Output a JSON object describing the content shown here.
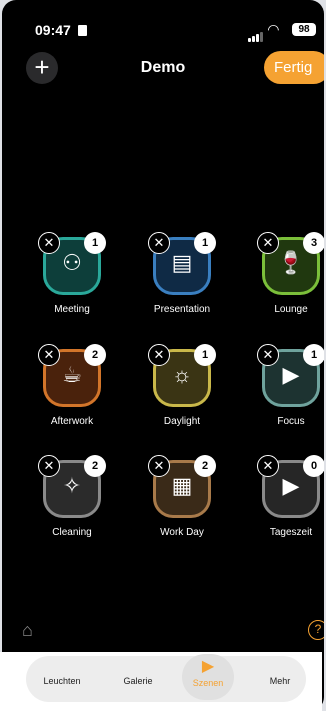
{
  "status": {
    "time": "09:47",
    "battery": "98"
  },
  "header": {
    "add_icon": "plus-icon",
    "title": "Demo",
    "done_label": "Fertig"
  },
  "colors": {
    "accent": "#f5a232"
  },
  "scenes": [
    {
      "label": "Meeting",
      "count": "1",
      "icon": "people-icon",
      "glyph": "⚇",
      "border": "#2aa89a",
      "fill": "#0d3e3a"
    },
    {
      "label": "Presentation",
      "count": "1",
      "icon": "projector-icon",
      "glyph": "▤",
      "border": "#3a7fc0",
      "fill": "#0f2a45"
    },
    {
      "label": "Lounge",
      "count": "3",
      "icon": "wine-glass-icon",
      "glyph": "🍷",
      "border": "#7bbf3a",
      "fill": "#20380f"
    },
    {
      "label": "Afterwork",
      "count": "2",
      "icon": "coffee-cup-icon",
      "glyph": "☕",
      "border": "#d2752a",
      "fill": "#4a220c"
    },
    {
      "label": "Daylight",
      "count": "1",
      "icon": "sun-icon",
      "glyph": "☼",
      "border": "#c9b84a",
      "fill": "#3a3414"
    },
    {
      "label": "Focus",
      "count": "1",
      "icon": "video-icon",
      "glyph": "▶",
      "border": "#6fa39d",
      "fill": "#1d3331"
    },
    {
      "label": "Cleaning",
      "count": "2",
      "icon": "bucket-icon",
      "glyph": "✧",
      "border": "#8a8a8a",
      "fill": "#2b2b2b"
    },
    {
      "label": "Work Day",
      "count": "2",
      "icon": "dashboard-icon",
      "glyph": "▦",
      "border": "#a87a4a",
      "fill": "#3a2a18"
    },
    {
      "label": "Tageszeit",
      "count": "0",
      "icon": "video-icon",
      "glyph": "▶",
      "border": "#8a8a8a",
      "fill": "#262626"
    }
  ],
  "tabs": [
    {
      "label": "Leuchten"
    },
    {
      "label": "Galerie"
    },
    {
      "label": "Szenen",
      "icon": "scenes-icon"
    },
    {
      "label": "Mehr"
    }
  ]
}
